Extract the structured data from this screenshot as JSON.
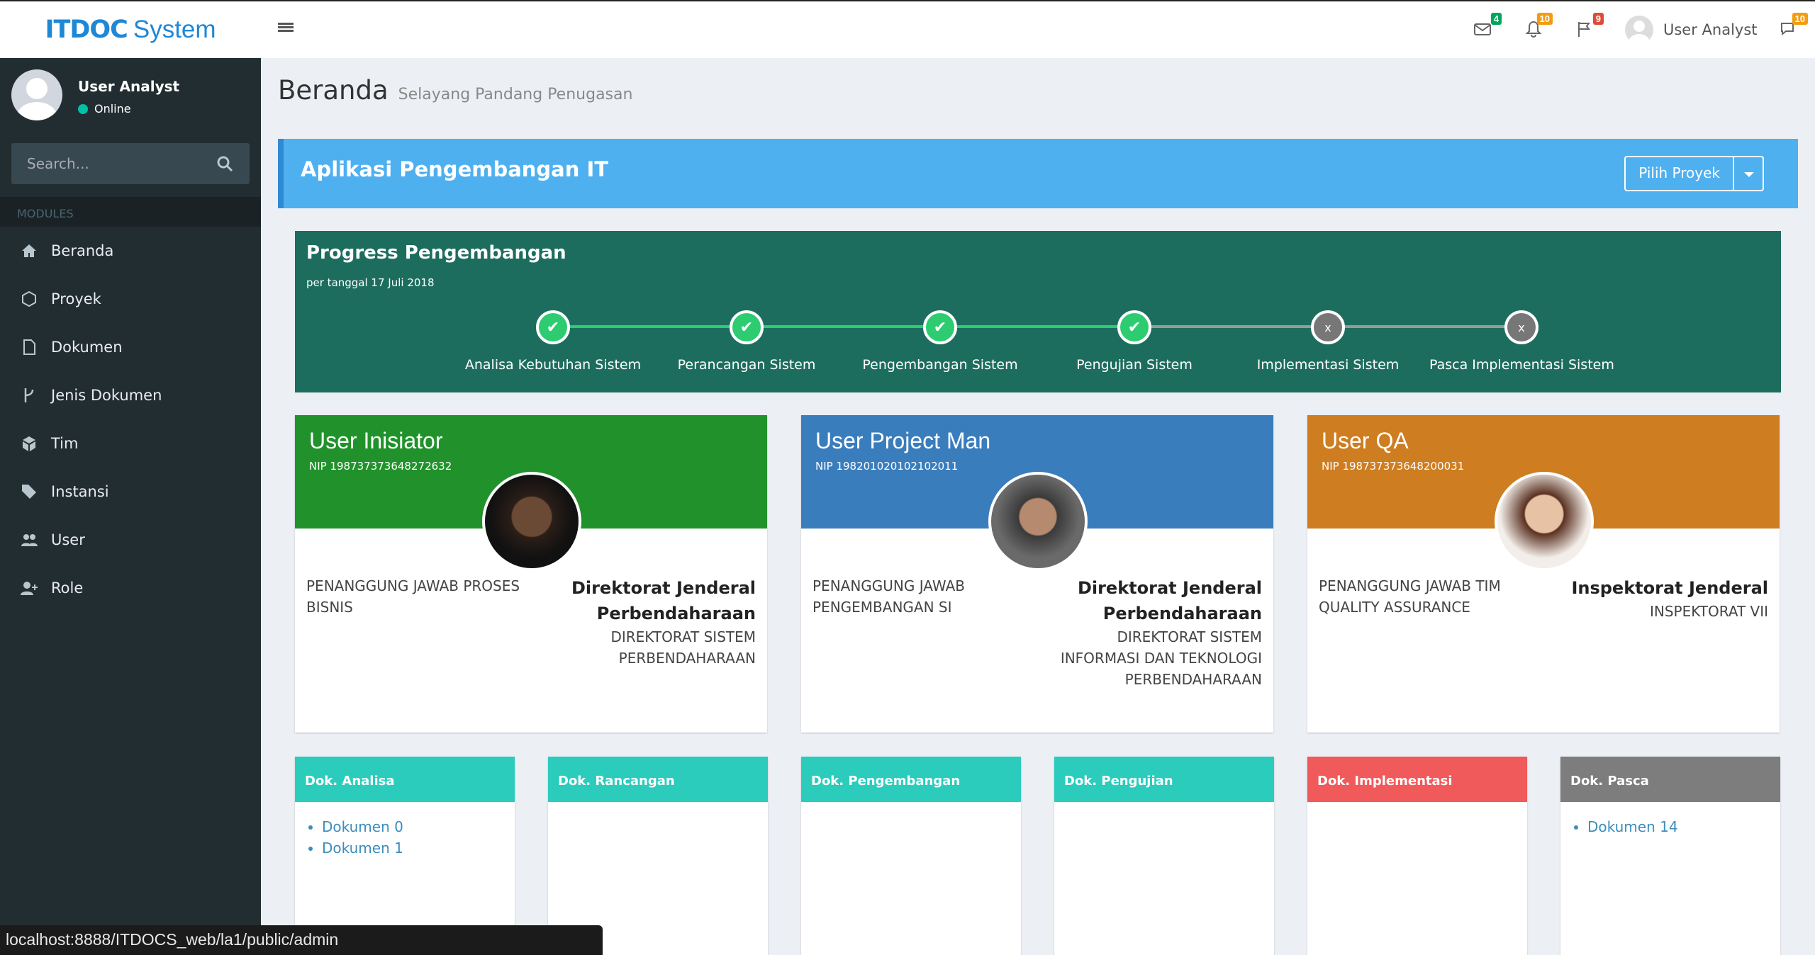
{
  "app": {
    "logo_bold": "ITDOC",
    "logo_rest": "System"
  },
  "topbar": {
    "mail_badge": "4",
    "bell_badge": "10",
    "flag_badge": "9",
    "user": "User Analyst",
    "chat_badge": "10"
  },
  "sidebar": {
    "user_name": "User Analyst",
    "status": "Online",
    "search_placeholder": "Search...",
    "modules_header": "MODULES",
    "items": [
      {
        "label": "Beranda",
        "icon": "home-icon"
      },
      {
        "label": "Proyek",
        "icon": "cube-icon"
      },
      {
        "label": "Dokumen",
        "icon": "pdf-file-icon"
      },
      {
        "label": "Jenis Dokumen",
        "icon": "branch-icon"
      },
      {
        "label": "Tim",
        "icon": "box-icon"
      },
      {
        "label": "Instansi",
        "icon": "tags-icon"
      },
      {
        "label": "User",
        "icon": "users-icon"
      },
      {
        "label": "Role",
        "icon": "user-plus-icon"
      }
    ]
  },
  "page": {
    "title": "Beranda",
    "subtitle": "Selayang Pandang Penugasan"
  },
  "banner": {
    "title": "Aplikasi Pengembangan IT",
    "button": "Pilih Proyek"
  },
  "progress": {
    "title": "Progress Pengembangan",
    "date": "per tanggal 17 Juli 2018",
    "steps": [
      {
        "label": "Analisa Kebutuhan Sistem",
        "mark": "✔",
        "done": true
      },
      {
        "label": "Perancangan Sistem",
        "mark": "✔",
        "done": true
      },
      {
        "label": "Pengembangan Sistem",
        "mark": "✔",
        "done": true
      },
      {
        "label": "Pengujian Sistem",
        "mark": "✔",
        "done": true
      },
      {
        "label": "Implementasi Sistem",
        "mark": "x",
        "done": false
      },
      {
        "label": "Pasca Implementasi Sistem",
        "mark": "x",
        "done": false
      }
    ]
  },
  "users": [
    {
      "title": "User Inisiator",
      "nip": "NIP 198737373648272632",
      "role": "PENANGGUNG JAWAB PROSES BISNIS",
      "org_bold": "Direktorat Jenderal Perbendaharaan",
      "org": "DIREKTORAT SISTEM PERBENDAHARAAN",
      "color": "#21922b"
    },
    {
      "title": "User Project Man",
      "nip": "NIP 198201020102102011",
      "role": "PENANGGUNG JAWAB PENGEMBANGAN SI",
      "org_bold": "Direktorat Jenderal Perbendaharaan",
      "org": "DIREKTORAT SISTEM INFORMASI DAN TEKNOLOGI PERBENDAHARAAN",
      "color": "#3a7dbd"
    },
    {
      "title": "User QA",
      "nip": "NIP 198737373648200031",
      "role": "PENANGGUNG JAWAB TIM QUALITY ASSURANCE",
      "org_bold": "Inspektorat Jenderal",
      "org": "INSPEKTORAT VII",
      "color": "#ce7d20"
    }
  ],
  "docs": [
    {
      "title": "Dok. Analisa",
      "items": [
        "Dokumen 0",
        "Dokumen 1"
      ],
      "color": "#2cccbc"
    },
    {
      "title": "Dok. Rancangan",
      "items": [],
      "color": "#2cccbc"
    },
    {
      "title": "Dok. Pengembangan",
      "items": [],
      "color": "#2cccbc"
    },
    {
      "title": "Dok. Pengujian",
      "items": [],
      "color": "#2cccbc"
    },
    {
      "title": "Dok. Implementasi",
      "items": [],
      "color": "#f05a5a"
    },
    {
      "title": "Dok. Pasca",
      "items": [
        "Dokumen 14"
      ],
      "color": "#7d7d7d"
    }
  ],
  "statusbar": "localhost:8888/ITDOCS_web/la1/public/admin"
}
